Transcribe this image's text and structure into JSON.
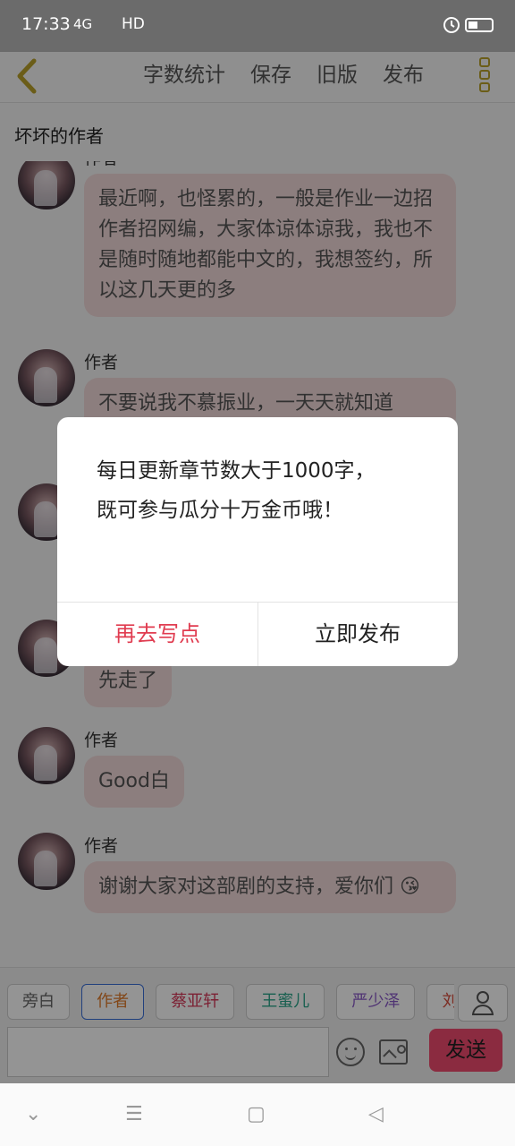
{
  "status_bar": {
    "time": "17:33",
    "signal": "4G",
    "network": "HD"
  },
  "top_bar": {
    "actions": [
      "字数统计",
      "保存",
      "旧版",
      "发布"
    ],
    "accent_color": "#b8a02a"
  },
  "chat_title": "坏坏的作者",
  "messages": [
    {
      "speaker": "作者",
      "text": "最近啊，也怪累的，一般是作业一边招作者招网编，大家体谅体谅我，我也不是随时随地都能中文的，我想签约，所以这几天更的多"
    },
    {
      "speaker": "作者",
      "text": "不要说我不慕振业，一天天就知道"
    },
    {
      "speaker": "",
      "text": ""
    },
    {
      "speaker": "",
      "text": "先走了"
    },
    {
      "speaker": "作者",
      "text": "Good白"
    },
    {
      "speaker": "作者",
      "text": "谢谢大家对这部剧的支持，爱你们 😘"
    }
  ],
  "characters": [
    {
      "name": "旁白",
      "color": "#666666",
      "selected": false
    },
    {
      "name": "作者",
      "color": "#e07a2a",
      "selected": true
    },
    {
      "name": "蔡亚轩",
      "color": "#d63a5a",
      "selected": false
    },
    {
      "name": "王蜜儿",
      "color": "#2aa58a",
      "selected": false
    },
    {
      "name": "严少泽",
      "color": "#8a5ac8",
      "selected": false
    },
    {
      "name": "刘",
      "color": "#d64a3a",
      "selected": false
    }
  ],
  "input": {
    "value": "",
    "placeholder": ""
  },
  "send_label": "发送",
  "dialog": {
    "message_line1": "每日更新章节数大于1000字，",
    "message_line2": "既可参与瓜分十万金币哦！",
    "cancel_label": "再去写点",
    "confirm_label": "立即发布"
  }
}
